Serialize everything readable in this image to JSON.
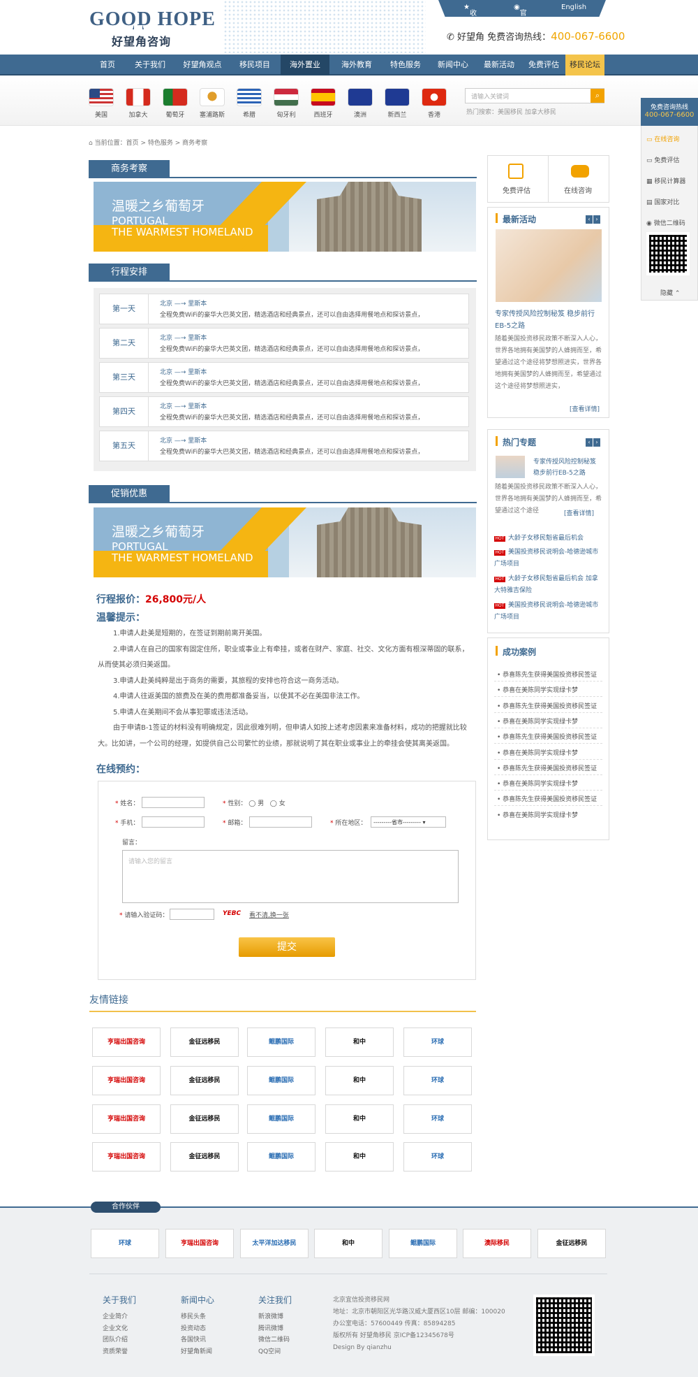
{
  "brand": {
    "en": "GOOD  HOPE",
    "cn": "好望角咨询"
  },
  "topnav": [
    "收藏本站",
    "官方微博",
    "English"
  ],
  "hotline": {
    "label": "好望角 免费咨询热线：",
    "number": "400-067-6600"
  },
  "nav": [
    "首页",
    "关于我们",
    "好望角观点",
    "移民项目",
    "海外置业",
    "海外教育",
    "特色服务",
    "新闻中心",
    "最新活动",
    "免费评估",
    "移民论坛"
  ],
  "flags": [
    "美国",
    "加拿大",
    "葡萄牙",
    "塞浦路斯",
    "希腊",
    "匈牙利",
    "西班牙",
    "澳洲",
    "新西兰",
    "香港"
  ],
  "search": {
    "placeholder": "请输入关键词",
    "hot": "热门搜索：美国移民   加拿大移民"
  },
  "crumb": "当前位置：首页 > 特色服务 > 商务考察",
  "sections": {
    "s1": "商务考察",
    "s2": "行程安排",
    "s3": "促销优惠"
  },
  "banner": {
    "title": "温暖之乡葡萄牙",
    "en1": "PORTUGAL",
    "en2": "THE WARMEST HOMELAND"
  },
  "schedule": {
    "route_from": "北京",
    "route_to": "里斯本",
    "desc": "全程免费WiFi的豪华大巴英文团，精选酒店和经典景点，还可以自由选择用餐地点和探访景点，",
    "days": [
      "第一天",
      "第二天",
      "第三天",
      "第四天",
      "第五天"
    ]
  },
  "price": {
    "label": "行程报价：",
    "value": "26,800元/人"
  },
  "tips": {
    "title": "温馨提示：",
    "items": [
      "1.申请人赴美是短期的，在签证到期前离开美国。",
      "2.申请人在自己的国家有固定住所，职业或事业上有牵挂，或者在财产、家庭、社交、文化方面有根深蒂固的联系，从而使其必须归美返国。",
      "3.申请人赴美纯粹是出于商务的需要，其旅程的安排也符合这一商务活动。",
      "4.申请人往返美国的旅费及在美的费用都准备妥当，以使其不必在美国非法工作。",
      "5.申请人在美期间不会从事犯罪或违法活动。",
      "由于申请B-1签证的材料没有明确规定，因此很难列明，但申请人如按上述考虑因素来准备材料，成功的把握就比较大。比如讲，一个公司的经理，如提供自己公司繁忙的业绩，那就说明了其在职业或事业上的牵挂会使其离美返国。"
    ]
  },
  "order": {
    "title": "在线预约：",
    "name": "姓名：",
    "gender": "性别：",
    "male": "男",
    "female": "女",
    "phone": "手机：",
    "email": "邮箱：",
    "region": "所在地区：",
    "region_value": "---------省市---------",
    "msg": "留言：",
    "msg_ph": "请输入您的留言",
    "captcha": "请输入验证码：",
    "code": "YEBC",
    "refresh": "看不清,换一张",
    "submit": "提交"
  },
  "links": {
    "title": "友情链接",
    "names": [
      "亨瑞出国咨询",
      "金征远移民",
      "鲲鹏国际",
      "和中",
      "环球"
    ]
  },
  "partner": {
    "tag": "合作伙伴",
    "names": [
      "环球",
      "亨瑞出国咨询",
      "太平洋加达移民",
      "和中",
      "鲲鹏国际",
      "澳际移民",
      "金征远移民"
    ]
  },
  "footer": {
    "cols": [
      {
        "title": "关于我们",
        "items": [
          "企业简介",
          "企业文化",
          "团队介绍",
          "资质荣誉"
        ]
      },
      {
        "title": "新闻中心",
        "items": [
          "移民头条",
          "投资动态",
          "各国快讯",
          "好望角新闻"
        ]
      },
      {
        "title": "关注我们",
        "items": [
          "新浪微博",
          "腾讯微博",
          "微信二维码",
          "QQ空间"
        ]
      }
    ],
    "addr": [
      "北京宜信投资移民网",
      "地址：北京市朝阳区光华路汉威大厦西区10层 邮编：100020",
      "办公室电话：57600449 传真：85894285",
      "版权所有 好望角移民 京ICP备12345678号",
      "Design By qianzhu"
    ]
  },
  "sidebar": {
    "eval": "免费评估",
    "consult": "在线咨询",
    "latest": "最新活动",
    "latest_title": "专家传授风险控制秘笈 稳步前行EB-5之路",
    "latest_text": "随着美国投资移民政策不断深入人心，世界各地拥有美国梦的人蜂拥而至，希望通过这个途径将梦想照进实，世界各地拥有美国梦的人蜂拥而至，希望通过这个途径将梦想照进实，",
    "more": "[查看详情]",
    "hot": "热门专题",
    "hot_title": "专家传授风险控制秘笈 稳步前行EB-5之路",
    "hot_text": "随着美国投资移民政策不断深入人心，世界各地拥有美国梦的人蜂拥而至，希望通过这个途径",
    "hotlist": [
      "大龄子女移民魁省最后机会",
      "美国投资移民说明会-哈德逊城市广场项目",
      "大龄子女移民魁省最后机会 加拿大特雅吉保险",
      "美国投资移民说明会-哈德逊城市广场项目"
    ],
    "cases": "成功案例",
    "case_items": [
      "恭喜陈先生获得美国投资移民签证",
      "恭喜在美陈同学实现绿卡梦"
    ]
  },
  "float": {
    "title": "免费咨询热线",
    "phone": "400-067-6600",
    "items": [
      "在线咨询",
      "免费评估",
      "移民计算器",
      "国家对比",
      "微信二维码"
    ],
    "hide": "隐藏"
  }
}
